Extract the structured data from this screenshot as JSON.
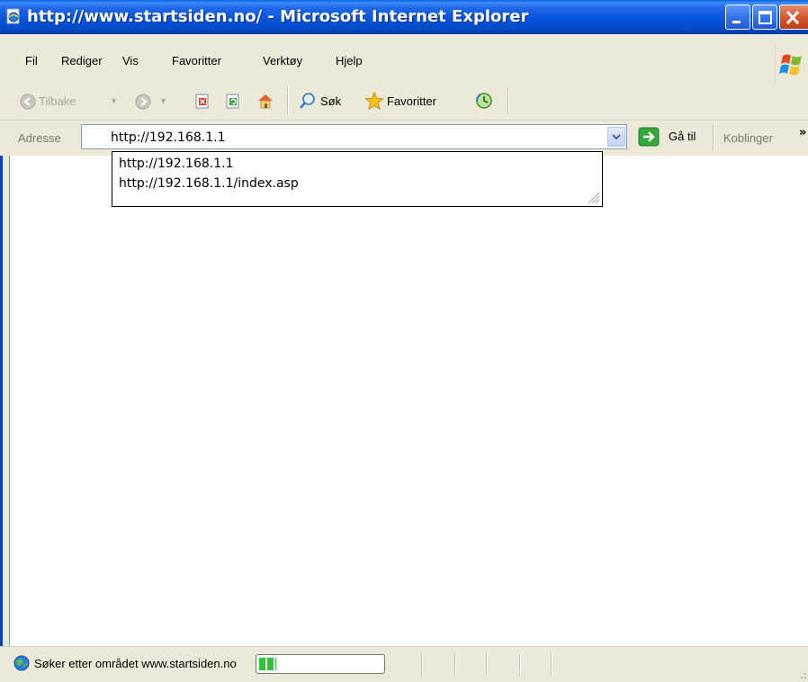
{
  "window": {
    "title": "http://www.startsiden.no/ - Microsoft Internet Explorer"
  },
  "menu": {
    "items": [
      "Fil",
      "Rediger",
      "Vis",
      "Favoritter",
      "Verktøy",
      "Hjelp"
    ]
  },
  "toolbar": {
    "back_label": "Tilbake",
    "search_label": "Søk",
    "favorites_label": "Favoritter"
  },
  "address": {
    "label": "Adresse",
    "value": "http://192.168.1.1",
    "go_label": "Gå til",
    "links_label": "Koblinger",
    "links_chevron": "»"
  },
  "autocomplete": {
    "items": [
      "http://192.168.1.1",
      "http://192.168.1.1/index.asp"
    ]
  },
  "status": {
    "text": "Søker etter området www.startsiden.no",
    "progress_fraction": 0.14
  },
  "colors": {
    "titlebar": "#0655db",
    "chrome": "#ece9d8",
    "close_button": "#d4552e",
    "progress": "#2fc63b"
  }
}
